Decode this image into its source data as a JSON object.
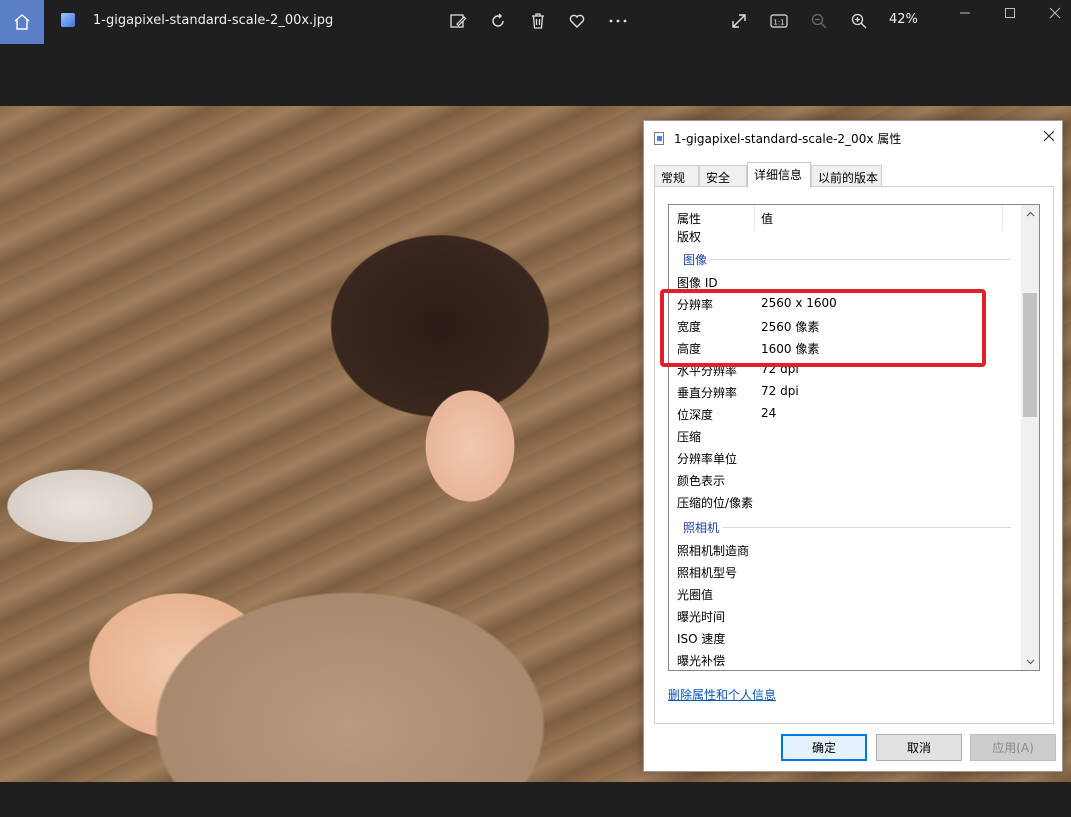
{
  "viewer": {
    "file_name": "1-gigapixel-standard-scale-2_00x.jpg",
    "zoom": "42%",
    "actual_size_label": "1:1",
    "window_controls": [
      "minimize-icon",
      "maximize-icon",
      "close-icon"
    ],
    "toolbar_icons": [
      "edit-image-icon",
      "rotate-icon",
      "delete-icon",
      "favorite-heart-icon",
      "more-icon",
      "fullscreen-icon",
      "actual-size-icon",
      "zoom-out-icon",
      "zoom-in-icon"
    ],
    "accent": "#5a7fc4"
  },
  "dialog": {
    "title": "1-gigapixel-standard-scale-2_00x 属性",
    "tabs": [
      {
        "label": "常规"
      },
      {
        "label": "安全"
      },
      {
        "label": "详细信息"
      },
      {
        "label": "以前的版本"
      }
    ],
    "active_tab": "详细信息",
    "columns": {
      "property": "属性",
      "value": "值"
    },
    "rows": [
      {
        "key": "版权",
        "value": ""
      },
      {
        "group": "图像"
      },
      {
        "key": "图像 ID",
        "value": ""
      },
      {
        "key": "分辨率",
        "value": "2560 x 1600"
      },
      {
        "key": "宽度",
        "value": "2560 像素"
      },
      {
        "key": "高度",
        "value": "1600 像素"
      },
      {
        "key": "水平分辨率",
        "value": "72 dpi"
      },
      {
        "key": "垂直分辨率",
        "value": "72 dpi"
      },
      {
        "key": "位深度",
        "value": "24"
      },
      {
        "key": "压缩",
        "value": ""
      },
      {
        "key": "分辨率单位",
        "value": ""
      },
      {
        "key": "颜色表示",
        "value": ""
      },
      {
        "key": "压缩的位/像素",
        "value": ""
      },
      {
        "group": "照相机"
      },
      {
        "key": "照相机制造商",
        "value": ""
      },
      {
        "key": "照相机型号",
        "value": ""
      },
      {
        "key": "光圈值",
        "value": ""
      },
      {
        "key": "曝光时间",
        "value": ""
      },
      {
        "key": "ISO 速度",
        "value": ""
      },
      {
        "key": "曝光补偿",
        "value": ""
      }
    ],
    "remove_link": "删除属性和个人信息",
    "buttons": {
      "ok": "确定",
      "cancel": "取消",
      "apply": "应用(A)"
    },
    "highlight_color": "#e2202b"
  }
}
